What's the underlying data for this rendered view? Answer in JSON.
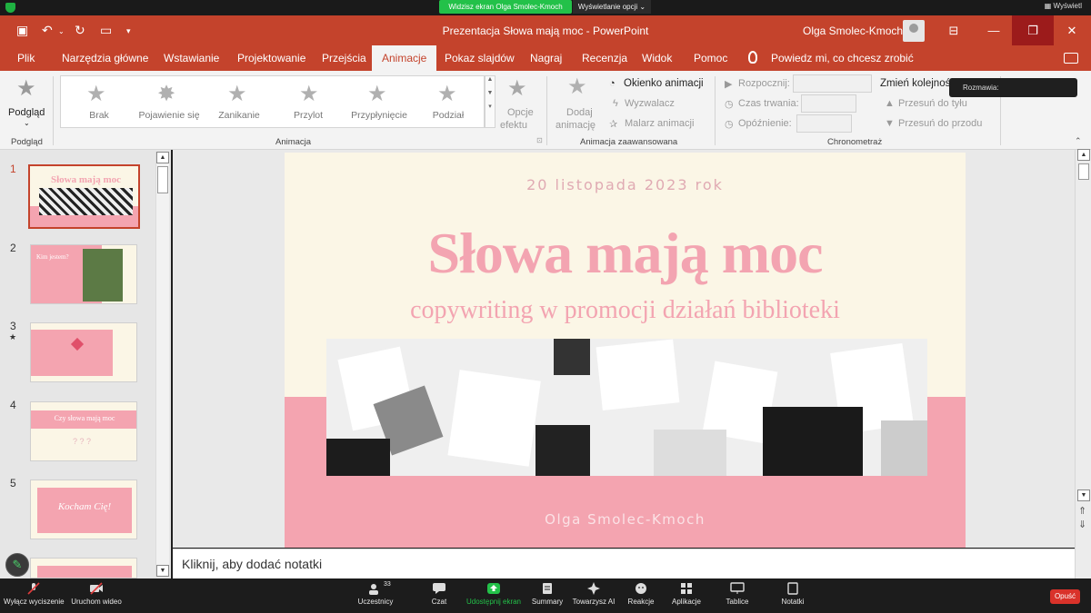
{
  "zoom": {
    "sharing_banner": "Widzisz ekran Olga Smolec-Kmoch",
    "view_options": "Wyświetlanie opcji",
    "display_label": "Wyświetl",
    "toolbar": {
      "mute": "Wyłącz wyciszenie",
      "video": "Uruchom wideo",
      "participants": "Uczestnicy",
      "participants_count": "33",
      "chat": "Czat",
      "share": "Udostępnij ekran",
      "summary": "Summary",
      "ai": "Towarzysz AI",
      "reactions": "Reakcje",
      "apps": "Aplikacje",
      "whiteboard": "Tablice",
      "notes": "Notatki",
      "leave": "Opuść"
    },
    "tooltip": "Rozmawia:"
  },
  "window": {
    "title": "Prezentacja Słowa mają moc  -  PowerPoint",
    "user": "Olga Smolec-Kmoch"
  },
  "tabs": [
    "Plik",
    "Narzędzia główne",
    "Wstawianie",
    "Projektowanie",
    "Przejścia",
    "Animacje",
    "Pokaz slajdów",
    "Nagraj",
    "Recenzja",
    "Widok",
    "Pomoc"
  ],
  "active_tab": "Animacje",
  "tellme": "Powiedz mi, co chcesz zrobić",
  "ribbon": {
    "preview": {
      "label": "Podgląd",
      "group": "Podgląd"
    },
    "animations": {
      "items": [
        "Brak",
        "Pojawienie się",
        "Zanikanie",
        "Przylot",
        "Przypłynięcie",
        "Podział"
      ],
      "effect_options": [
        "Opcje",
        "efektu"
      ],
      "group": "Animacja"
    },
    "advanced": {
      "add": [
        "Dodaj",
        "animację"
      ],
      "pane": "Okienko animacji",
      "trigger": "Wyzwalacz",
      "painter": "Malarz animacji",
      "group": "Animacja zaawansowana"
    },
    "timing": {
      "start": "Rozpocznij:",
      "duration": "Czas trwania:",
      "delay": "Opóźnienie:",
      "reorder": "Zmień kolejność",
      "back": "Przesuń do tyłu",
      "forward": "Przesuń do przodu",
      "group": "Chronometraż"
    }
  },
  "thumbnails": [
    {
      "num": "1",
      "title": "Słowa mają moc"
    },
    {
      "num": "2",
      "title": "Kim jestem?"
    },
    {
      "num": "3",
      "title": ""
    },
    {
      "num": "4",
      "title": "Czy słowa mają moc"
    },
    {
      "num": "5",
      "title": "Kocham Cię!"
    }
  ],
  "slide": {
    "date": "20 listopada 2023 rok",
    "title": "Słowa mają moc",
    "subtitle": "copywriting w promocji działań biblioteki",
    "author": "Olga Smolec-Kmoch"
  },
  "notes_placeholder": "Kliknij, aby dodać notatki"
}
